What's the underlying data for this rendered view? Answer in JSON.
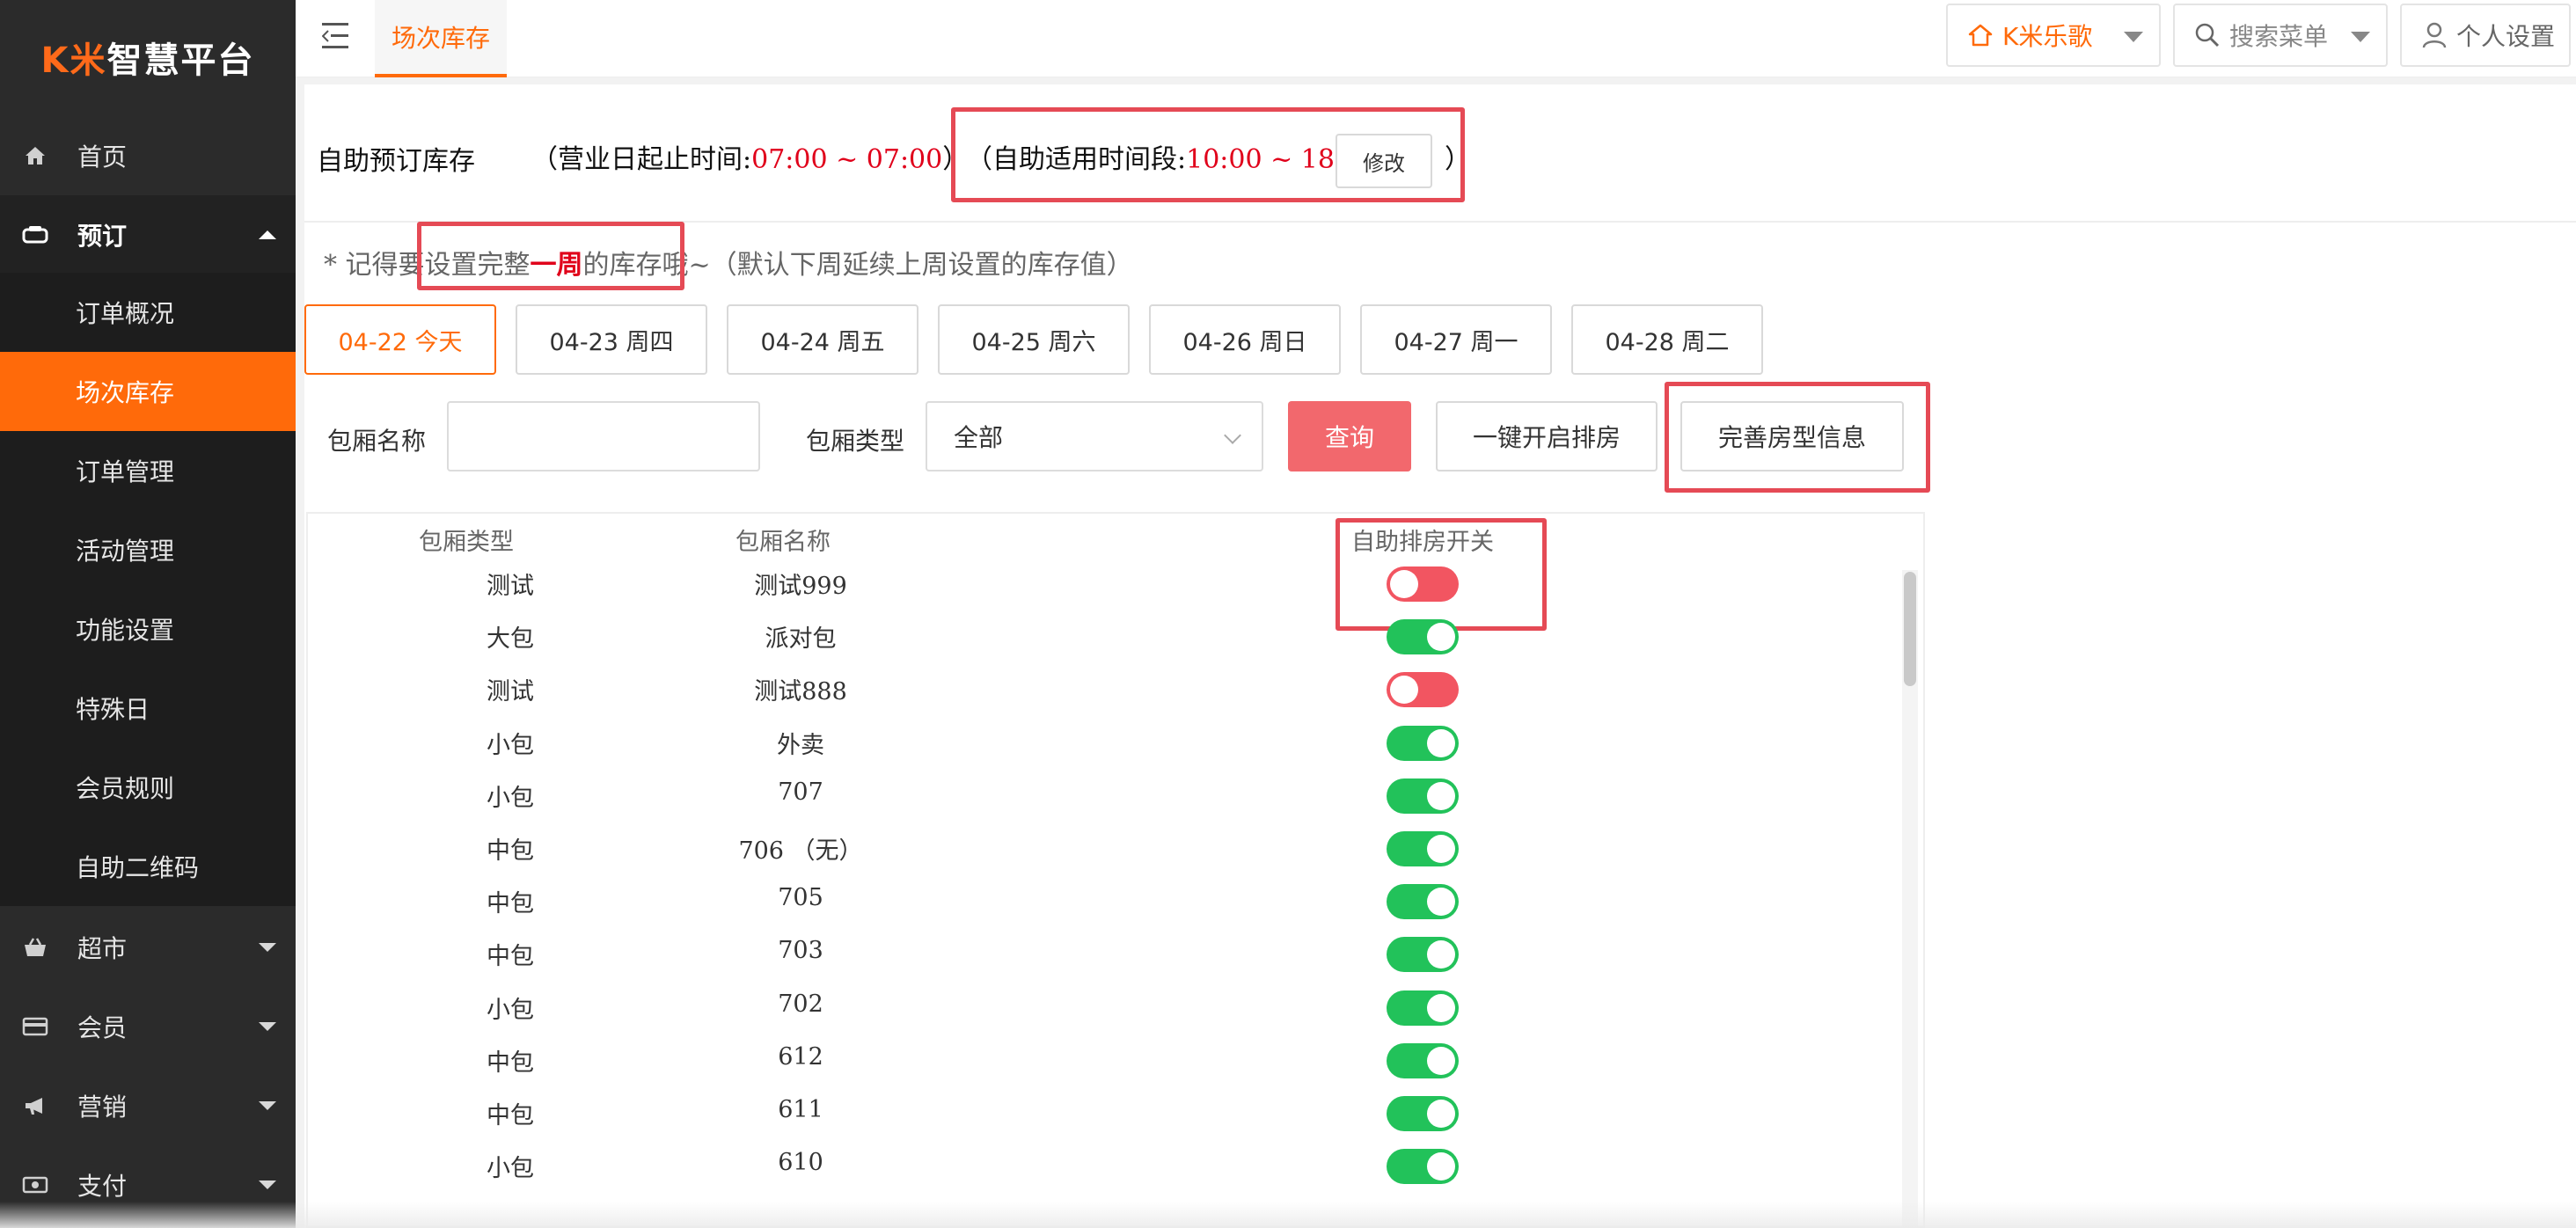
{
  "brand": {
    "logo_prefix": "K米",
    "logo_suffix": "智慧平台"
  },
  "sidebar": {
    "items": [
      {
        "label": "首页",
        "icon": "home-icon"
      },
      {
        "label": "预订",
        "icon": "booking-icon"
      },
      {
        "label": "超市",
        "icon": "basket-icon"
      },
      {
        "label": "会员",
        "icon": "card-icon"
      },
      {
        "label": "营销",
        "icon": "megaphone-icon"
      },
      {
        "label": "支付",
        "icon": "cash-icon"
      }
    ],
    "submenu": [
      "订单概况",
      "场次库存",
      "订单管理",
      "活动管理",
      "功能设置",
      "特殊日",
      "会员规则",
      "自助二维码"
    ],
    "active_sub": "场次库存"
  },
  "topbar": {
    "active_tab": "场次库存",
    "store": "K米乐歌",
    "search_placeholder": "搜索菜单",
    "settings": "个人设置"
  },
  "header": {
    "title": "自助预订库存",
    "range_prefix": "（营业日起止时间:",
    "range_value": "07:00 ~ 07:00",
    "range_suffix": "）",
    "self_prefix": "（自助适用时间段:",
    "self_value": "10:00 ~ 18:00",
    "edit_button": "修改",
    "self_suffix": "）"
  },
  "note": {
    "before": "* 记得要设置完整",
    "highlight": "一周",
    "after": "的库存哦~（默认下周延续上周设置的库存值）"
  },
  "date_tabs": [
    "04-22 今天",
    "04-23 周四",
    "04-24 周五",
    "04-25 周六",
    "04-26 周日",
    "04-27 周一",
    "04-28 周二"
  ],
  "active_date": "04-22 今天",
  "filters": {
    "name_label": "包厢名称",
    "name_value": "",
    "type_label": "包厢类型",
    "type_value": "全部",
    "query_button": "查询",
    "open_all_button": "一键开启排房",
    "perfect_button": "完善房型信息"
  },
  "table": {
    "headers": {
      "type": "包厢类型",
      "name": "包厢名称",
      "switch": "自助排房开关"
    },
    "rows": [
      {
        "type": "测试",
        "name": "测试999",
        "switch_on": false
      },
      {
        "type": "大包",
        "name": "派对包",
        "switch_on": true
      },
      {
        "type": "测试",
        "name": "测试888",
        "switch_on": false
      },
      {
        "type": "小包",
        "name": "外卖",
        "switch_on": true
      },
      {
        "type": "小包",
        "name": "707",
        "switch_on": true
      },
      {
        "type": "中包",
        "name": "706 （无）",
        "switch_on": true
      },
      {
        "type": "中包",
        "name": "705",
        "switch_on": true
      },
      {
        "type": "中包",
        "name": "703",
        "switch_on": true
      },
      {
        "type": "小包",
        "name": "702",
        "switch_on": true
      },
      {
        "type": "中包",
        "name": "612",
        "switch_on": true
      },
      {
        "type": "中包",
        "name": "611",
        "switch_on": true
      },
      {
        "type": "小包",
        "name": "610",
        "switch_on": true
      }
    ]
  },
  "colors": {
    "accent": "#ff6a0a",
    "sidebar_bg": "#2b2b2b",
    "switch_on": "#22c25a",
    "switch_off": "#f25561",
    "highlight_box": "#e54a55"
  }
}
